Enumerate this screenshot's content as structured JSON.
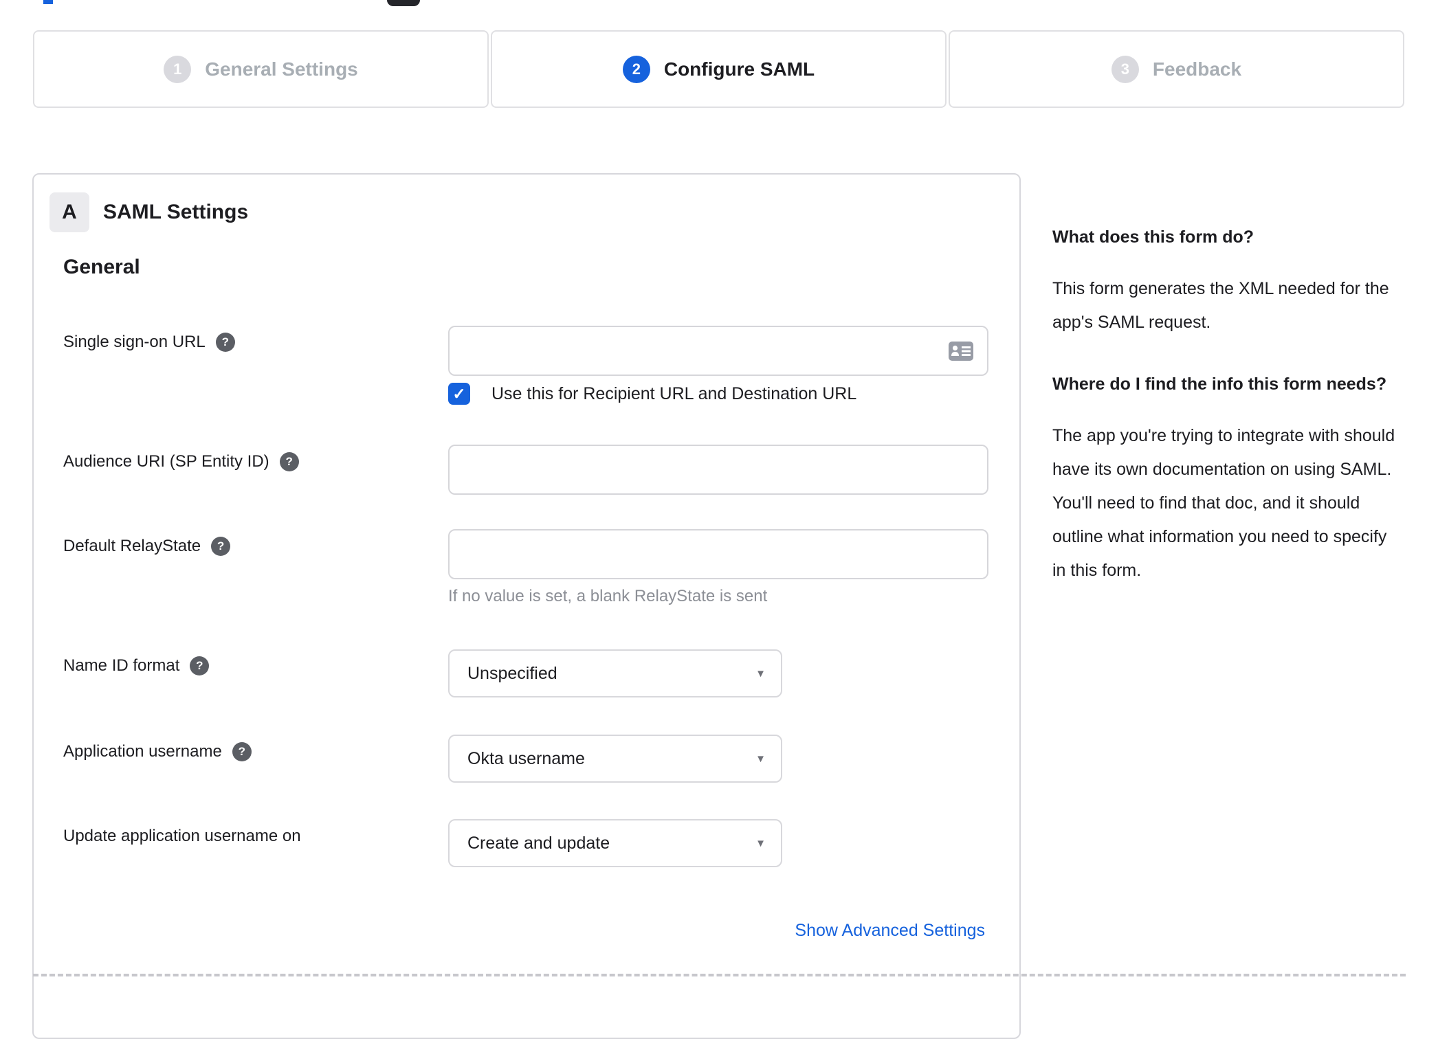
{
  "colors": {
    "accent": "#1662dd",
    "inactive_step": "#d9d9de",
    "inactive_label": "#a8aeb4",
    "border": "#d7d7dc",
    "hint_text": "#8c8f96"
  },
  "icons": {
    "help": "?",
    "caret": "▼",
    "check": "✓",
    "contact_card": "contact-card-icon"
  },
  "stepper": {
    "steps": [
      {
        "number": "1",
        "label": "General Settings",
        "state": "inactive"
      },
      {
        "number": "2",
        "label": "Configure SAML",
        "state": "active"
      },
      {
        "number": "3",
        "label": "Feedback",
        "state": "inactive"
      }
    ]
  },
  "form": {
    "section_badge": "A",
    "section_title": "SAML Settings",
    "group_heading": "General",
    "fields": {
      "sso": {
        "label": "Single sign-on URL",
        "value": "",
        "checkbox_label": "Use this for Recipient URL and Destination URL",
        "checkbox_checked": true
      },
      "audience": {
        "label": "Audience URI (SP Entity ID)",
        "value": ""
      },
      "relaystate": {
        "label": "Default RelayState",
        "value": "",
        "hint": "If no value is set, a blank RelayState is sent"
      },
      "nameid": {
        "label": "Name ID format",
        "value": "Unspecified"
      },
      "appusername": {
        "label": "Application username",
        "value": "Okta username"
      },
      "updateusername": {
        "label": "Update application username on",
        "value": "Create and update"
      }
    },
    "advanced_link": "Show Advanced Settings"
  },
  "help_panel": {
    "heading1": "What does this form do?",
    "body1": "This form generates the XML needed for the app's SAML request.",
    "heading2": "Where do I find the info this form needs?",
    "body2": "The app you're trying to integrate with should have its own documentation on using SAML. You'll need to find that doc, and it should outline what information you need to specify in this form."
  }
}
